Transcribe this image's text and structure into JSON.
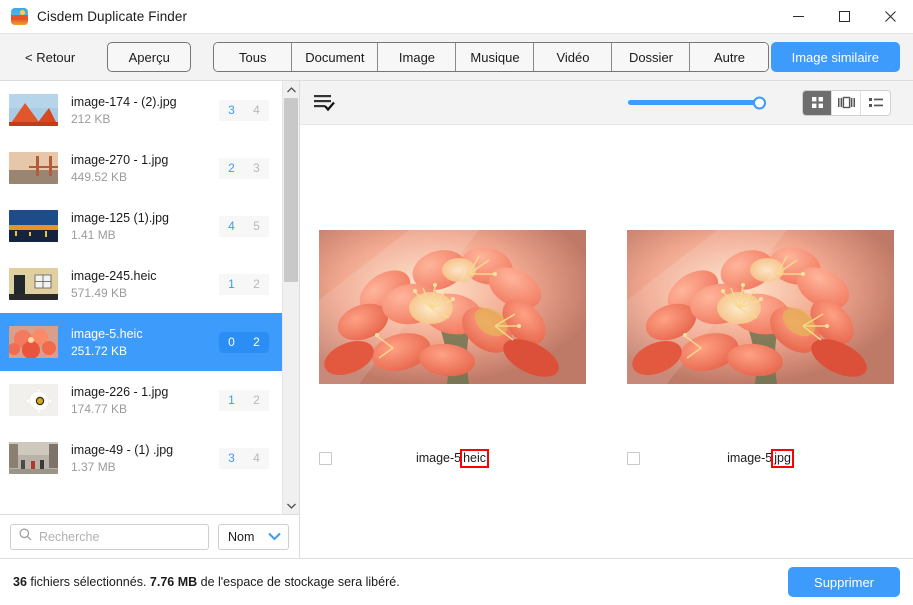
{
  "window": {
    "title": "Cisdem Duplicate Finder",
    "icon": "app-logo-icon",
    "controls": {
      "minimize": "minimize-icon",
      "maximize": "maximize-icon",
      "close": "close-icon"
    }
  },
  "toolbar": {
    "back_label": "< Retour",
    "preview_label": "Aperçu",
    "filters": [
      {
        "label": "Tous"
      },
      {
        "label": "Document"
      },
      {
        "label": "Image"
      },
      {
        "label": "Musique"
      },
      {
        "label": "Vidéo"
      },
      {
        "label": "Dossier"
      },
      {
        "label": "Autre"
      }
    ],
    "similar_label": "Image similaire"
  },
  "sidebar": {
    "files": [
      {
        "name": "image-174 - (2).jpg",
        "size": "212 KB",
        "dup": "3",
        "total": "4",
        "selected": false
      },
      {
        "name": "image-270 - 1.jpg",
        "size": "449.52 KB",
        "dup": "2",
        "total": "3",
        "selected": false
      },
      {
        "name": "image-125 (1).jpg",
        "size": "1.41 MB",
        "dup": "4",
        "total": "5",
        "selected": false
      },
      {
        "name": "image-245.heic",
        "size": "571.49 KB",
        "dup": "1",
        "total": "2",
        "selected": false
      },
      {
        "name": "image-5.heic",
        "size": "251.72 KB",
        "dup": "0",
        "total": "2",
        "selected": true
      },
      {
        "name": "image-226 - 1.jpg",
        "size": "174.77 KB",
        "dup": "1",
        "total": "2",
        "selected": false
      },
      {
        "name": "image-49 - (1) .jpg",
        "size": "1.37 MB",
        "dup": "3",
        "total": "4",
        "selected": false
      }
    ],
    "search": {
      "placeholder": "Recherche",
      "value": "",
      "icon": "search-icon"
    },
    "sort": {
      "value": "Nom",
      "icon": "chevron-down-icon"
    },
    "scrollbar": {
      "up": "chevron-up-icon",
      "down": "chevron-down-icon"
    }
  },
  "content": {
    "select_all_icon": "select-all-list-icon",
    "view_modes": [
      {
        "name": "grid-view",
        "icon": "grid-icon",
        "active": true
      },
      {
        "name": "carousel-view",
        "icon": "carousel-icon",
        "active": false
      },
      {
        "name": "list-view",
        "icon": "list-icon",
        "active": false
      }
    ],
    "zoom_slider": {
      "value": 100
    },
    "cards": [
      {
        "name_base": "image-5",
        "ext": "heic",
        "checked": false,
        "alt": "orange-flowers-photo"
      },
      {
        "name_base": "image-5",
        "ext": "jpg",
        "checked": false,
        "alt": "orange-flowers-photo"
      }
    ]
  },
  "footer": {
    "count": "36",
    "text_1": "fichiers sélectionnés.",
    "size": "7.76 MB",
    "text_2": "de l'espace de stockage sera libéré.",
    "delete_label": "Supprimer"
  },
  "colors": {
    "accent": "#3d9bfb",
    "highlight_box": "#ff0000",
    "toolbar_bg": "#f3f3f3",
    "badge_dup": "#3d9bfb",
    "badge_total": "#b9b9b9"
  }
}
